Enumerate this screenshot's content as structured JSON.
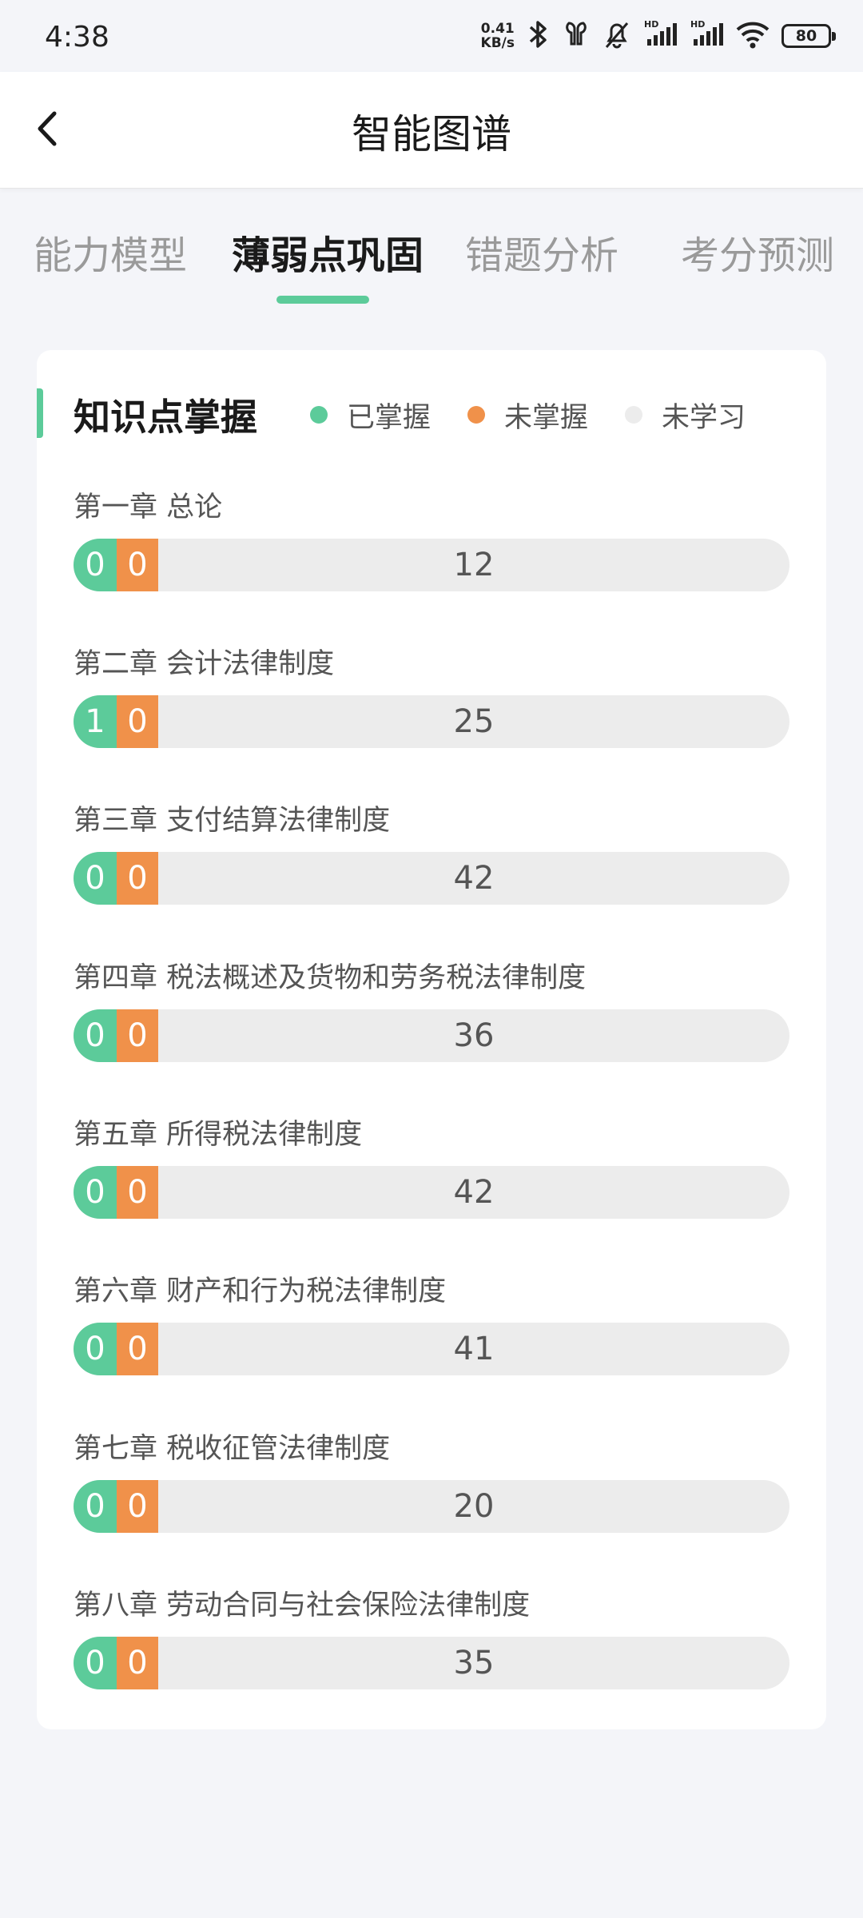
{
  "status_bar": {
    "time": "4:38",
    "net_speed_value": "0.41",
    "net_speed_unit": "KB/s",
    "battery": "80",
    "icons": [
      "bluetooth-icon",
      "earbuds-icon",
      "mute-bell-icon",
      "signal-hd-1-icon",
      "signal-hd-2-icon",
      "wifi-icon",
      "battery-icon"
    ]
  },
  "header": {
    "back_icon": "chevron-left-icon",
    "title": "智能图谱"
  },
  "tabs": [
    {
      "label": "能力模型",
      "active": false
    },
    {
      "label": "薄弱点巩固",
      "active": true
    },
    {
      "label": "错题分析",
      "active": false
    },
    {
      "label": "考分预测",
      "active": false
    }
  ],
  "card": {
    "title": "知识点掌握",
    "legend": [
      {
        "label": "已掌握",
        "color": "#5ccb9a"
      },
      {
        "label": "未掌握",
        "color": "#f0914a"
      },
      {
        "label": "未学习",
        "color": "#ececec"
      }
    ],
    "chapters": [
      {
        "title": "第一章 总论",
        "mastered": "0",
        "unmastered": "0",
        "unlearned": "12"
      },
      {
        "title": "第二章 会计法律制度",
        "mastered": "1",
        "unmastered": "0",
        "unlearned": "25"
      },
      {
        "title": "第三章 支付结算法律制度",
        "mastered": "0",
        "unmastered": "0",
        "unlearned": "42"
      },
      {
        "title": "第四章 税法概述及货物和劳务税法律制度",
        "mastered": "0",
        "unmastered": "0",
        "unlearned": "36"
      },
      {
        "title": "第五章 所得税法律制度",
        "mastered": "0",
        "unmastered": "0",
        "unlearned": "42"
      },
      {
        "title": "第六章 财产和行为税法律制度",
        "mastered": "0",
        "unmastered": "0",
        "unlearned": "41"
      },
      {
        "title": "第七章 税收征管法律制度",
        "mastered": "0",
        "unmastered": "0",
        "unlearned": "20"
      },
      {
        "title": "第八章 劳动合同与社会保险法律制度",
        "mastered": "0",
        "unmastered": "0",
        "unlearned": "35"
      }
    ]
  },
  "colors": {
    "accent": "#5ccb9a",
    "mastered": "#5ccb9a",
    "unmastered": "#f0914a",
    "unlearned": "#ececec"
  }
}
